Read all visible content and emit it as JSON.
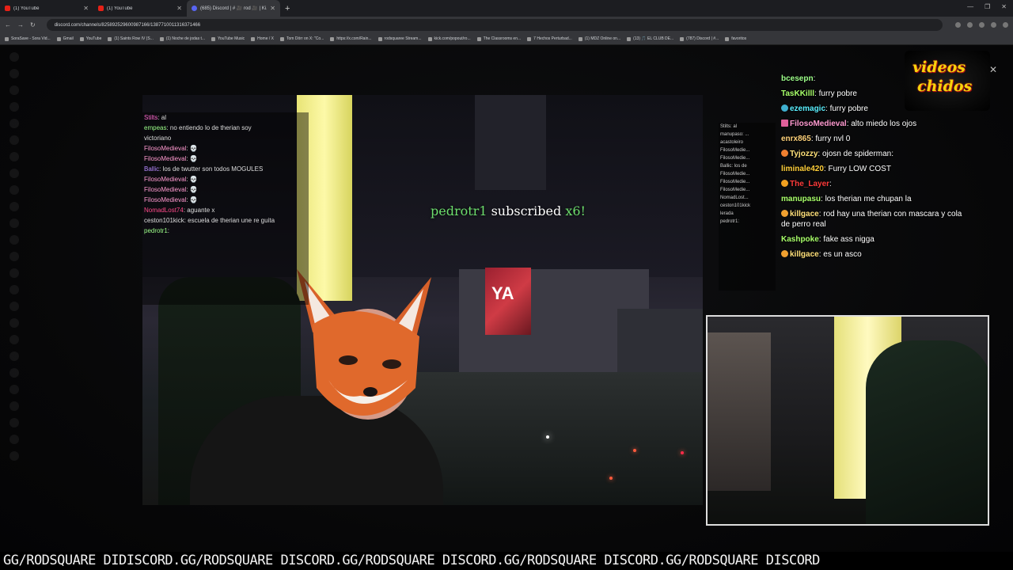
{
  "browser": {
    "tabs": [
      {
        "label": "(1) YouTube",
        "active": false
      },
      {
        "label": "(1) YouTube",
        "active": false
      },
      {
        "label": "(685) Discord | # 🎥 rod 🎥 | Ki...",
        "active": true
      }
    ],
    "url": "discord.com/channels/825892529600987166/1387710011316371466",
    "bookmarks": [
      "SoraSave - Sora Vid...",
      "Gmail",
      "YouTube",
      "(1) Saints Row IV (S...",
      "(1) Noche de jodas t...",
      "YouTube Music",
      "Home / X",
      "Tom Dörr on X: \"Co...",
      "https://x.com/Rain...",
      "rodsquaree Stream...",
      "kick.com/popout/ro...",
      "The Classrooms en...",
      "7 Hechos Perturbad...",
      "(1) MDZ Online on...",
      "(13) 🎵 EL CLUB DE...",
      "(787) Discord | #...",
      "favoritos"
    ]
  },
  "stream_overlay_chat": [
    {
      "user": "Stilts",
      "text": "al"
    },
    {
      "user": "empeas",
      "text": "no entiendo lo de therian soy"
    },
    {
      "user": "",
      "text": "victoriano"
    },
    {
      "user": "FilosoMedieval",
      "text": "💀"
    },
    {
      "user": "FilosoMedieval",
      "text": "💀"
    },
    {
      "user": "Ballic",
      "text": "los de twutter son todos MOGULES"
    },
    {
      "user": "FilosoMedieval",
      "text": "💀"
    },
    {
      "user": "FilosoMedieval",
      "text": "💀"
    },
    {
      "user": "FilosoMedieval",
      "text": "💀"
    },
    {
      "user": "NomadLost74",
      "text": "aguante x"
    },
    {
      "user": "ceston101kick",
      "text": "escuela de therian une re guita"
    },
    {
      "user": "pedrotr1",
      "text": ""
    }
  ],
  "sub_alert": {
    "user": "pedrotr1",
    "text": "subscribed",
    "count": "x6!"
  },
  "chat": [
    {
      "user": "bcesepn",
      "text": "",
      "color": "#9dff8a",
      "badge": ""
    },
    {
      "user": "TasKKilll",
      "text": "furry pobre",
      "color": "#a8ff6a",
      "badge": ""
    },
    {
      "user": "ezemagic",
      "text": "furry pobre",
      "color": "#5af0ff",
      "badge": "#3fb0d0"
    },
    {
      "user": "FilosoMedieval",
      "text": "alto miedo los ojos",
      "color": "#ff9ad0",
      "badge": "#e0609a"
    },
    {
      "user": "enrx865",
      "text": "furry nvl 0",
      "color": "#ffd27a",
      "badge": ""
    },
    {
      "user": "Tyjozzy",
      "text": "ojosn de spiderman:",
      "color": "#ffe27a",
      "badge": "#f08030"
    },
    {
      "user": "liminale420",
      "text": "Furry LOW COST",
      "color": "#ffcf3a",
      "badge": ""
    },
    {
      "user": "The_Layer",
      "text": "",
      "color": "#ff3b3b",
      "badge": "#f0a020"
    },
    {
      "user": "manupasu",
      "text": "los therian me chupan la",
      "color": "#a8ff6a",
      "badge": ""
    },
    {
      "user": "killgace",
      "text": "rod hay una therian con mascara y cola de perro real",
      "color": "#ffe07a",
      "badge": "#f0a030"
    },
    {
      "user": "Kashpoke",
      "text": "fake ass nigga",
      "color": "#a8ff6a",
      "badge": ""
    },
    {
      "user": "killgace",
      "text": "es un asco",
      "color": "#ffe07a",
      "badge": "#f0a030"
    }
  ],
  "mini_chat": [
    "Stilts: al",
    "manupaso: ...",
    "acastoleiro",
    "FilosoMedie...",
    "FilosoMedie...",
    "Ballic: los de",
    "FilosoMedie...",
    "FilosoMedie...",
    "FilosoMedie...",
    "NomadLost...",
    "ceston101kick",
    "lerada",
    "pedrotr1:"
  ],
  "logo": {
    "line1": "videos",
    "line2": "chidos"
  },
  "ticker": "GG/RODSQUARE DIDISCORD.GG/RODSQUARE DISCORD.GG/RODSQUARE DISCORD.GG/RODSQUARE DISCORD.GG/RODSQUARE DISCORD",
  "colors": {
    "accent": "#5865f2",
    "sub_green": "#6dde6d",
    "logo_yellow": "#f6d40a"
  }
}
